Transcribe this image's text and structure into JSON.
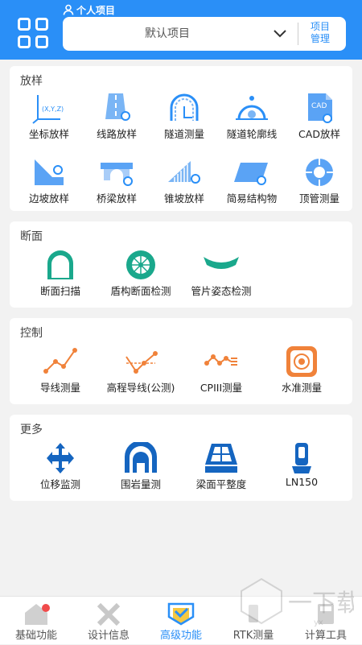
{
  "header": {
    "user_label": "个人项目",
    "project_name": "默认项目",
    "manage_label_line1": "项目",
    "manage_label_line2": "管理"
  },
  "sections": [
    {
      "title": "放样",
      "items": [
        {
          "label": "坐标放样",
          "icon": "coordinate-axes-icon",
          "icon_text": "(X,Y,Z)"
        },
        {
          "label": "线路放样",
          "icon": "road-route-icon"
        },
        {
          "label": "隧道测量",
          "icon": "tunnel-measure-icon"
        },
        {
          "label": "隧道轮廓线",
          "icon": "tunnel-contour-icon"
        },
        {
          "label": "CAD放样",
          "icon": "cad-file-icon",
          "icon_text": "CAD"
        },
        {
          "label": "边坡放样",
          "icon": "slope-icon"
        },
        {
          "label": "桥梁放样",
          "icon": "bridge-icon"
        },
        {
          "label": "锥坡放样",
          "icon": "cone-slope-icon"
        },
        {
          "label": "简易结构物",
          "icon": "simple-structure-icon"
        },
        {
          "label": "顶管测量",
          "icon": "pipe-jacking-icon"
        }
      ]
    },
    {
      "title": "断面",
      "items": [
        {
          "label": "断面扫描",
          "icon": "section-scan-icon"
        },
        {
          "label": "盾构断面检测",
          "icon": "shield-section-icon"
        },
        {
          "label": "管片姿态检测",
          "icon": "segment-attitude-icon"
        }
      ]
    },
    {
      "title": "控制",
      "items": [
        {
          "label": "导线测量",
          "icon": "traverse-icon"
        },
        {
          "label": "高程导线(公测)",
          "icon": "elevation-traverse-icon"
        },
        {
          "label": "CPIII测量",
          "icon": "cpiii-icon"
        },
        {
          "label": "水准测量",
          "icon": "leveling-icon"
        }
      ]
    },
    {
      "title": "更多",
      "items": [
        {
          "label": "位移监测",
          "icon": "displacement-icon"
        },
        {
          "label": "围岩量测",
          "icon": "surrounding-rock-icon"
        },
        {
          "label": "梁面平整度",
          "icon": "beam-flatness-icon"
        },
        {
          "label": "LN150",
          "icon": "ln150-device-icon"
        }
      ]
    }
  ],
  "tabs": [
    {
      "label": "基础功能",
      "icon": "home-icon",
      "badge": true
    },
    {
      "label": "设计信息",
      "icon": "ruler-pencil-icon"
    },
    {
      "label": "高级功能",
      "icon": "advanced-icon",
      "active": true
    },
    {
      "label": "RTK测量",
      "icon": "rtk-icon"
    },
    {
      "label": "计算工具",
      "icon": "calculator-icon"
    }
  ],
  "watermark": {
    "text": "一下载",
    "sub": "yx"
  },
  "colors": {
    "primary": "#2a8ff7",
    "orange": "#f0823a",
    "teal": "#1aa88c",
    "bg": "#f2f2f2"
  }
}
